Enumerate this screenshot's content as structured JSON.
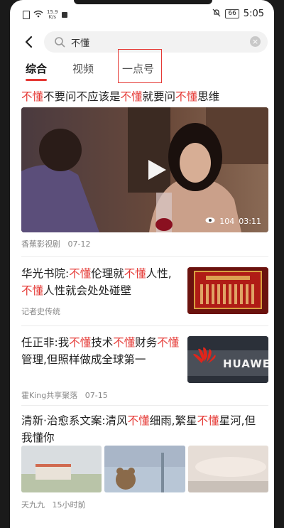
{
  "status": {
    "net_speed_value": "15.9",
    "net_speed_unit": "K/s",
    "battery": "66",
    "time": "5:05"
  },
  "search": {
    "query": "不懂"
  },
  "tabs": [
    {
      "label": "综合",
      "active": true
    },
    {
      "label": "视频",
      "active": false
    },
    {
      "label": "一点号",
      "active": false
    }
  ],
  "feed": [
    {
      "title_parts": [
        "不懂",
        "不要问不应该是",
        "不懂",
        "就要问",
        "不懂",
        "思维"
      ],
      "source": "香蕉影视剧",
      "date": "07-12",
      "views": "104",
      "duration": "03:11"
    },
    {
      "title_parts": [
        "华光书院:",
        "不懂",
        "伦理就",
        "不懂",
        "人性,",
        "不懂",
        "人性就会处处碰壁"
      ],
      "source": "记者史传统"
    },
    {
      "title_parts": [
        "任正非:我",
        "不懂",
        "技术",
        "不懂",
        "财务",
        "不懂",
        "管理,但照样做成全球第一"
      ],
      "source": "霍King共享聚落",
      "date": "07-15",
      "thumb_logo": "HUAWEI"
    },
    {
      "title_parts": [
        "清新·治愈系文案:清风",
        "不懂",
        "细雨,繁星",
        "不懂",
        "星河,但我懂你"
      ],
      "source": "天九九",
      "date": "15小时前"
    }
  ],
  "colors": {
    "accent": "#e53935",
    "highlight_box": "#e53935"
  },
  "icons": [
    "back-arrow-icon",
    "search-icon",
    "clear-icon",
    "play-icon",
    "eye-icon"
  ]
}
